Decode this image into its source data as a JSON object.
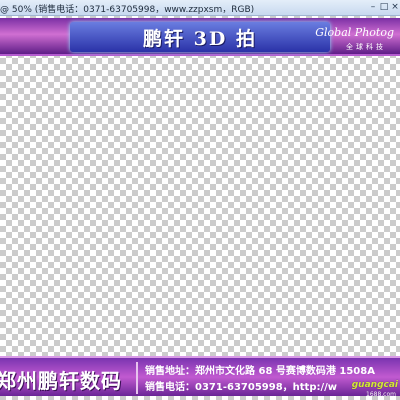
{
  "window": {
    "title": "@ 50% (销售电话：0371-63705998，www.zzpxsm，RGB)",
    "controls": {
      "minimize": "–",
      "maximize": "□",
      "close": "×"
    }
  },
  "top_banner": {
    "title": "鹏轩 3D 拍",
    "logo_en": "Global Photog",
    "logo_cn": "全球科技",
    "colors": {
      "band": "#2a32a8",
      "frame": "#7a2fa4"
    }
  },
  "bottom_banner": {
    "company": "郑州鹏轩数码",
    "address": "销售地址：郑州市文化路 68 号赛博数码港 1508A",
    "phone": "销售电话：0371-63705998，http://w"
  },
  "watermark": {
    "text": "guangcai",
    "sub": "1688.com"
  }
}
